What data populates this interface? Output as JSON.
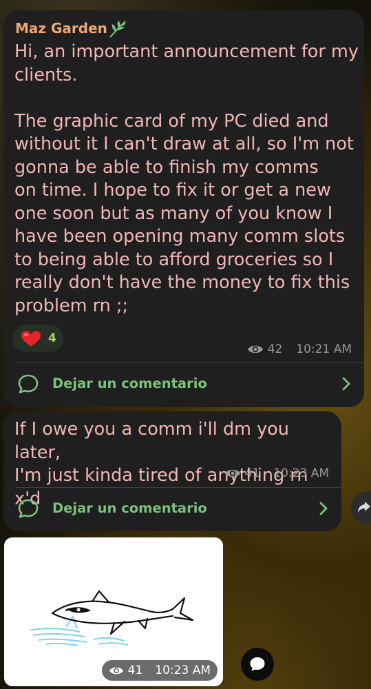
{
  "post1": {
    "author": "Maz Garden",
    "author_icon": "leaf-icon",
    "message": "Hi, an important announcement for my\nclients.\n\nThe graphic card of my PC died and\nwithout it I can't draw at all, so I'm not\ngonna be able to finish my comms\non time. I hope to fix it or get a new\none soon but as many of you know I\nhave been opening many comm slots\nto being able to afford groceries so I\nreally don't have the money to fix this\nproblem rn ;;",
    "reaction": {
      "icon": "heart-icon",
      "count": "4"
    },
    "views": "42",
    "time": "10:21 AM",
    "comment_label": "Dejar un comentario"
  },
  "post2": {
    "message": "If I owe you a comm i'll dm you later,\nI'm just kinda tired of anything rn x'd",
    "views": "41",
    "time": "10:23 AM",
    "comment_label": "Dejar un comentario"
  },
  "post3": {
    "image": "shark-drawing",
    "views": "41",
    "time": "10:23 AM"
  },
  "colors": {
    "bubble": "#1f1f1f",
    "message_text": "#f2b6b8",
    "author": "#f0a870",
    "accent_green": "#7cc47e",
    "meta_text": "#9a9a9a"
  }
}
